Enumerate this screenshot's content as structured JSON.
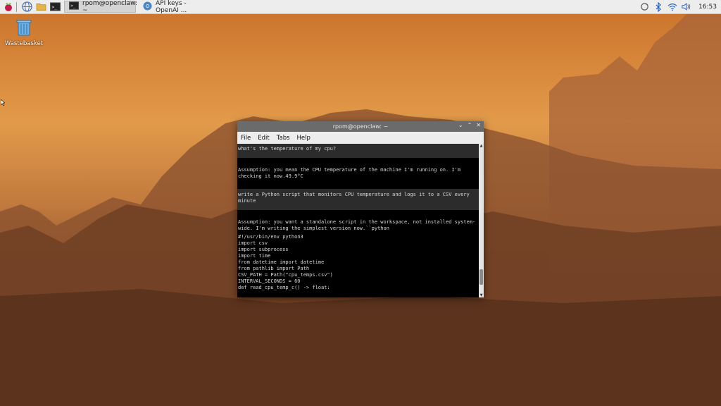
{
  "taskbar": {
    "menu_icon": "raspberry-pi-icon",
    "launchers": [
      "browser-icon",
      "file-manager-icon",
      "terminal-icon"
    ],
    "tasks": [
      {
        "label": "rpom@openclaw: ~",
        "icon": "terminal-icon",
        "active": true
      },
      {
        "label": "API keys - OpenAI ...",
        "icon": "chromium-icon",
        "active": false
      }
    ],
    "tray": [
      "sync-icon",
      "bluetooth-icon",
      "wifi-icon",
      "volume-icon"
    ],
    "clock": "16:53"
  },
  "desktop": {
    "icons": [
      {
        "label": "Wastebasket",
        "icon": "trash-icon"
      }
    ]
  },
  "terminal": {
    "title": "rpom@openclaw: ~",
    "menu": [
      "File",
      "Edit",
      "Tabs",
      "Help"
    ],
    "prompt1": "what's the temperature of my cpu?",
    "answer1": "Assumption: you mean the CPU temperature of the machine I'm running on. I'm checking it now.49.9°C",
    "prompt2": "write a Python script that monitors CPU temperature and logs it to a CSV every minute",
    "answer2": "Assumption: you want a standalone script in the workspace, not installed system-wide. I'm writing the simplest version now.``python",
    "code": [
      "#!/usr/bin/env python3",
      "import csv",
      "import subprocess",
      "import time",
      "from datetime import datetime",
      "from pathlib import Path",
      "",
      "CSV_PATH = Path(\"cpu_temps.csv\")",
      "INTERVAL_SECONDS = 60",
      "",
      "def read_cpu_temp_c() -> float:"
    ]
  }
}
